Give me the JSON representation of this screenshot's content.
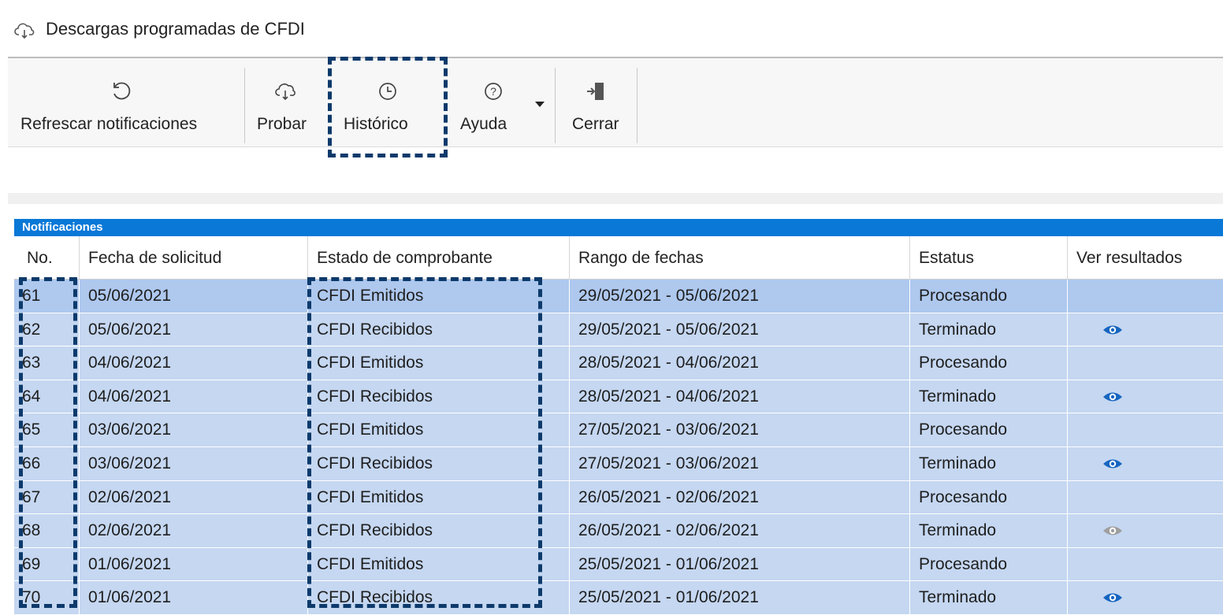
{
  "window": {
    "title": "Descargas programadas de CFDI",
    "icon": "cloud-download-icon"
  },
  "toolbar": {
    "refresh_label": "Refrescar notificaciones",
    "probar_label": "Probar",
    "historico_label": "Histórico",
    "ayuda_label": "Ayuda",
    "cerrar_label": "Cerrar"
  },
  "grid": {
    "group_title": "Notificaciones",
    "columns": [
      "No.",
      "Fecha de solicitud",
      "Estado de comprobante",
      "Rango de fechas",
      "Estatus",
      "Ver resultados"
    ],
    "rows": [
      {
        "no": "61",
        "fecha": "05/06/2021",
        "estado": "CFDI Emitidos",
        "rango": "29/05/2021 - 05/06/2021",
        "estatus": "Procesando",
        "ver": ""
      },
      {
        "no": "62",
        "fecha": "05/06/2021",
        "estado": "CFDI Recibidos",
        "rango": "29/05/2021 - 05/06/2021",
        "estatus": "Terminado",
        "ver": "eye-icon"
      },
      {
        "no": "63",
        "fecha": "04/06/2021",
        "estado": "CFDI Emitidos",
        "rango": "28/05/2021 - 04/06/2021",
        "estatus": "Procesando",
        "ver": ""
      },
      {
        "no": "64",
        "fecha": "04/06/2021",
        "estado": "CFDI Recibidos",
        "rango": "28/05/2021 - 04/06/2021",
        "estatus": "Terminado",
        "ver": "eye-icon"
      },
      {
        "no": "65",
        "fecha": "03/06/2021",
        "estado": "CFDI Emitidos",
        "rango": "27/05/2021 - 03/06/2021",
        "estatus": "Procesando",
        "ver": ""
      },
      {
        "no": "66",
        "fecha": "03/06/2021",
        "estado": "CFDI Recibidos",
        "rango": "27/05/2021 - 03/06/2021",
        "estatus": "Terminado",
        "ver": "eye-icon"
      },
      {
        "no": "67",
        "fecha": "02/06/2021",
        "estado": "CFDI Emitidos",
        "rango": "26/05/2021 - 02/06/2021",
        "estatus": "Procesando",
        "ver": ""
      },
      {
        "no": "68",
        "fecha": "02/06/2021",
        "estado": "CFDI Recibidos",
        "rango": "26/05/2021 - 02/06/2021",
        "estatus": "Terminado",
        "ver": "eye-icon-disabled"
      },
      {
        "no": "69",
        "fecha": "01/06/2021",
        "estado": "CFDI Emitidos",
        "rango": "25/05/2021 - 01/06/2021",
        "estatus": "Procesando",
        "ver": ""
      },
      {
        "no": "70",
        "fecha": "01/06/2021",
        "estado": "CFDI Recibidos",
        "rango": "25/05/2021 - 01/06/2021",
        "estatus": "Terminado",
        "ver": "eye-icon"
      }
    ]
  },
  "colors": {
    "accent": "#0a78d7",
    "row_bg": "#c5d7f1",
    "row_selected_bg": "#aec8ee",
    "highlight_dash": "#0d3a6b",
    "eye_active": "#1565c0",
    "eye_disabled": "#9e9e9e"
  }
}
